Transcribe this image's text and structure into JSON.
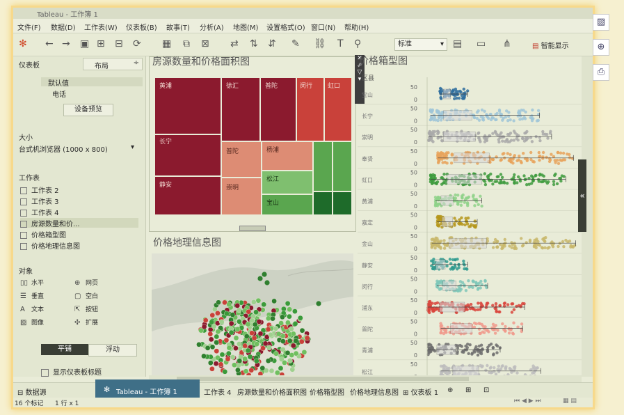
{
  "window": {
    "title": "Tableau - 工作簿 1"
  },
  "menu": [
    "文件(F)",
    "数据(D)",
    "工作表(W)",
    "仪表板(B)",
    "故事(T)",
    "分析(A)",
    "地图(M)",
    "设置格式(O)",
    "窗口(N)",
    "帮助(H)"
  ],
  "toolbar": {
    "fit_value": "标准",
    "show_me_label": "智能显示"
  },
  "left_panel": {
    "tab_dashboard": "仪表板",
    "tab_layout": "布局",
    "device_default": "默认值",
    "device_phone": "电话",
    "device_preview_button": "设备预览",
    "size_header": "大小",
    "size_value": "台式机浏览器 (1000 x 800)",
    "sheets_header": "工作表",
    "sheets": [
      "工作表 2",
      "工作表 3",
      "工作表 4",
      "房源数量和价...",
      "价格箱型图",
      "价格地理信息图"
    ],
    "objects_header": "对象",
    "objects": [
      "水平",
      "网页",
      "垂直",
      "空白",
      "文本",
      "按钮",
      "图像",
      "扩展"
    ],
    "tiled": "平铺",
    "floating": "浮动",
    "show_title": "显示仪表板标题"
  },
  "treemap": {
    "title": "房源数量和价格面积图",
    "cells": [
      {
        "label": "黄浦",
        "color": "#8b1a2e"
      },
      {
        "label": "徐汇",
        "color": "#8b1a2e"
      },
      {
        "label": "普陀",
        "color": "#8b1a2e"
      },
      {
        "label": "闵行",
        "color": "#c9413a"
      },
      {
        "label": "虹口",
        "color": "#c9413a"
      },
      {
        "label": "长宁",
        "color": "#8b1a2e"
      },
      {
        "label": "普陀",
        "color": "#dd8c74"
      },
      {
        "label": "杨浦",
        "color": "#dd8c74"
      },
      {
        "label": "静安",
        "color": "#8b1a2e"
      },
      {
        "label": "崇明",
        "color": "#dd8c74"
      },
      {
        "label": "松江",
        "color": "#7fbf6f"
      },
      {
        "label": "宝山",
        "color": "#5aa64f"
      }
    ]
  },
  "map": {
    "title": "价格地理信息图"
  },
  "boxplot": {
    "title": "价格箱型图",
    "header": "区县",
    "tick_top": "50",
    "tick_bottom": "0",
    "rows": [
      {
        "label": "宝山",
        "color": "#2f6f9f"
      },
      {
        "label": "长宁",
        "color": "#9fc6d8"
      },
      {
        "label": "崇明",
        "color": "#a9a9a9"
      },
      {
        "label": "奉贤",
        "color": "#e8a35c"
      },
      {
        "label": "虹口",
        "color": "#3e9b3e"
      },
      {
        "label": "黄浦",
        "color": "#8fd28a"
      },
      {
        "label": "嘉定",
        "color": "#b5961b"
      },
      {
        "label": "金山",
        "color": "#c8b76b"
      },
      {
        "label": "静安",
        "color": "#2f9b8f"
      },
      {
        "label": "闵行",
        "color": "#7fc7b9"
      },
      {
        "label": "浦东",
        "color": "#d9453c"
      },
      {
        "label": "普陀",
        "color": "#f09a8c"
      },
      {
        "label": "青浦",
        "color": "#6e6e6e"
      },
      {
        "label": "松江",
        "color": "#bdbdbd"
      }
    ]
  },
  "bottom_tabs": {
    "datasource": "数据源",
    "sheet4": "工作表 4",
    "area": "房源数量和价格面积图",
    "box": "价格箱型图",
    "geo": "价格地理信息图",
    "dash": "仪表板 1"
  },
  "taskbar": {
    "app_title": "Tableau - 工作簿 1"
  },
  "status": {
    "marks": "16 个标记",
    "rows": "1 行 x 1"
  }
}
